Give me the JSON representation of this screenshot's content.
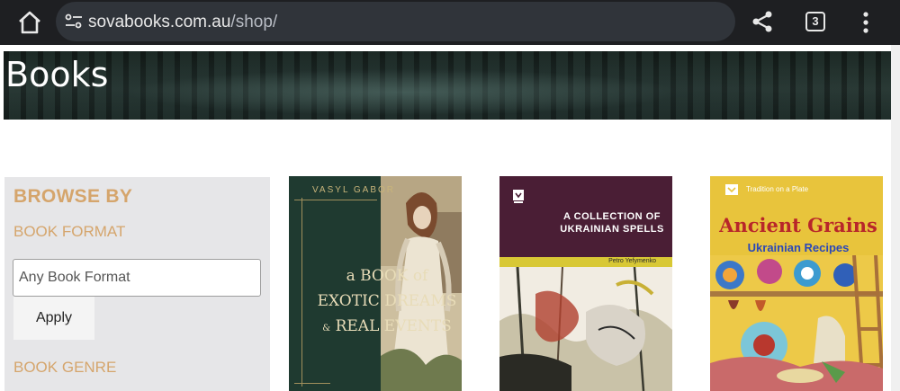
{
  "browser": {
    "url_domain": "sovabooks.com.au",
    "url_path": "/shop/",
    "tab_count": "3",
    "icons": [
      "home-icon",
      "site-info-icon",
      "share-icon",
      "tab-switcher-icon",
      "more-options-icon"
    ]
  },
  "hero": {
    "title": "Books"
  },
  "sidebar": {
    "heading": "BROWSE BY",
    "format_label": "BOOK FORMAT",
    "format_value": "",
    "format_placeholder": "Any Book Format",
    "apply_label": "Apply",
    "genre_label": "BOOK GENRE"
  },
  "books": [
    {
      "author": "VASYL GABOR",
      "title_lines": [
        "a BOOK of",
        "EXOTIC DREAMS",
        "REAL EVENTS"
      ],
      "connector": "&"
    },
    {
      "title_lines": [
        "A COLLECTION OF",
        "UKRAINIAN SPELLS"
      ],
      "author": "Petro Yefymenko"
    },
    {
      "tag": "Tradition on a Plate",
      "title": "Ancient Grains",
      "subtitle": "Ukrainian Recipes"
    }
  ],
  "colors": {
    "accent": "#d5a56c",
    "chrome": "#1e1f22",
    "sidebar_bg": "#e6e6e8"
  }
}
